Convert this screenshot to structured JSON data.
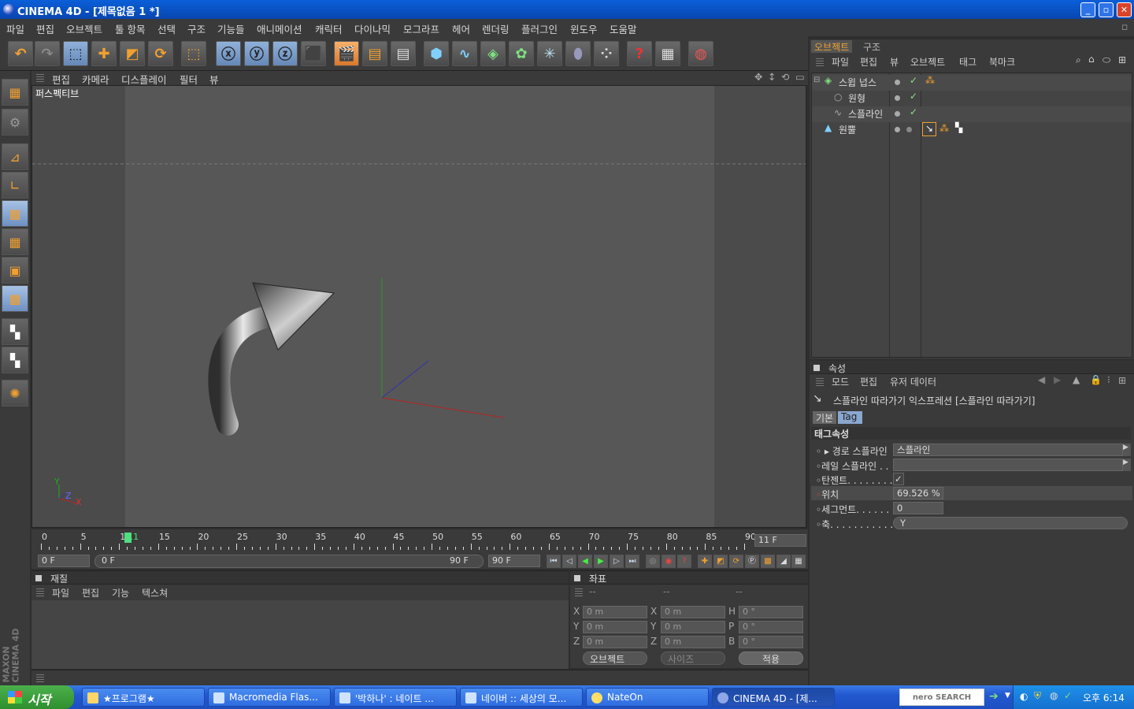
{
  "window": {
    "title": "CINEMA 4D - [제목없음 1 *]"
  },
  "menubar": {
    "items": [
      "파일",
      "편집",
      "오브젝트",
      "툴 항목",
      "선택",
      "구조",
      "기능들",
      "애니메이션",
      "캐릭터",
      "다이나믹",
      "모그라프",
      "헤어",
      "렌더링",
      "플러그인",
      "윈도우",
      "도움말"
    ]
  },
  "viewport": {
    "menu": [
      "편집",
      "카메라",
      "디스플레이",
      "필터",
      "뷰"
    ],
    "title": "퍼스펙티브",
    "axis_labels": {
      "y": "Y",
      "z": "Z",
      "x": "X"
    }
  },
  "timeline": {
    "ruler_labels": [
      "0",
      "5",
      "10",
      "11",
      "15",
      "20",
      "25",
      "30",
      "35",
      "40",
      "45",
      "50",
      "55",
      "60",
      "65",
      "70",
      "75",
      "80",
      "85",
      "90"
    ],
    "current_frame": "11 F",
    "start_field": "0 F",
    "range_start": "0 F",
    "range_end": "90 F",
    "end_field": "90 F"
  },
  "materials": {
    "title": "재질",
    "menu": [
      "파일",
      "편집",
      "기능",
      "텍스쳐"
    ]
  },
  "coords": {
    "title": "좌표",
    "col_headers": [
      "--",
      "--",
      "--"
    ],
    "rows": [
      {
        "a": "X",
        "av": "0 m",
        "b": "X",
        "bv": "0 m",
        "c": "H",
        "cv": "0 °"
      },
      {
        "a": "Y",
        "av": "0 m",
        "b": "Y",
        "bv": "0 m",
        "c": "P",
        "cv": "0 °"
      },
      {
        "a": "Z",
        "av": "0 m",
        "b": "Z",
        "bv": "0 m",
        "c": "B",
        "cv": "0 °"
      }
    ],
    "mode_select": "오브젝트",
    "size_select": "사이즈",
    "apply": "적용"
  },
  "object_manager": {
    "tabs": [
      "오브젝트",
      "구조"
    ],
    "menu": [
      "파일",
      "편집",
      "뷰",
      "오브젝트",
      "태그",
      "북마크"
    ],
    "objects": [
      {
        "name": "스윕 넙스"
      },
      {
        "name": "원형"
      },
      {
        "name": "스플라인"
      },
      {
        "name": "원뿔"
      }
    ]
  },
  "attributes": {
    "title": "속성",
    "menu": [
      "모드",
      "편집",
      "유저 데이터"
    ],
    "heading": "스플라인 따라가기 익스프레션 [스플라인 따라가기]",
    "tabs": [
      "기본",
      "Tag"
    ],
    "section": "태그속성",
    "rows": [
      {
        "label": "경로 스플라인",
        "value": "스플라인"
      },
      {
        "label": "레일 스플라인 . .",
        "value": ""
      },
      {
        "label": "탄젠트. . . . . . . . .",
        "value": "✓"
      },
      {
        "label": "위치",
        "value": "69.526 %"
      },
      {
        "label": "세그먼트. . . . . . .",
        "value": "0"
      },
      {
        "label": "축. . . . . . . . . . . . .",
        "value": "Y"
      }
    ]
  },
  "taskbar": {
    "start": "시작",
    "buttons": [
      "★프로그램★",
      "Macromedia Flas...",
      "'박하나' : 네이트 ...",
      "네이버 :: 세상의 모...",
      "NateOn",
      "CINEMA 4D - [제..."
    ],
    "nero": "nero SEARCH",
    "clock": "오후 6:14"
  },
  "colors": {
    "accent_orange": "#f0a030",
    "ui_dark": "#3a3a3a",
    "viewport": "#575757",
    "xp_blue": "#245edb",
    "start_green": "#3c9e3c"
  }
}
